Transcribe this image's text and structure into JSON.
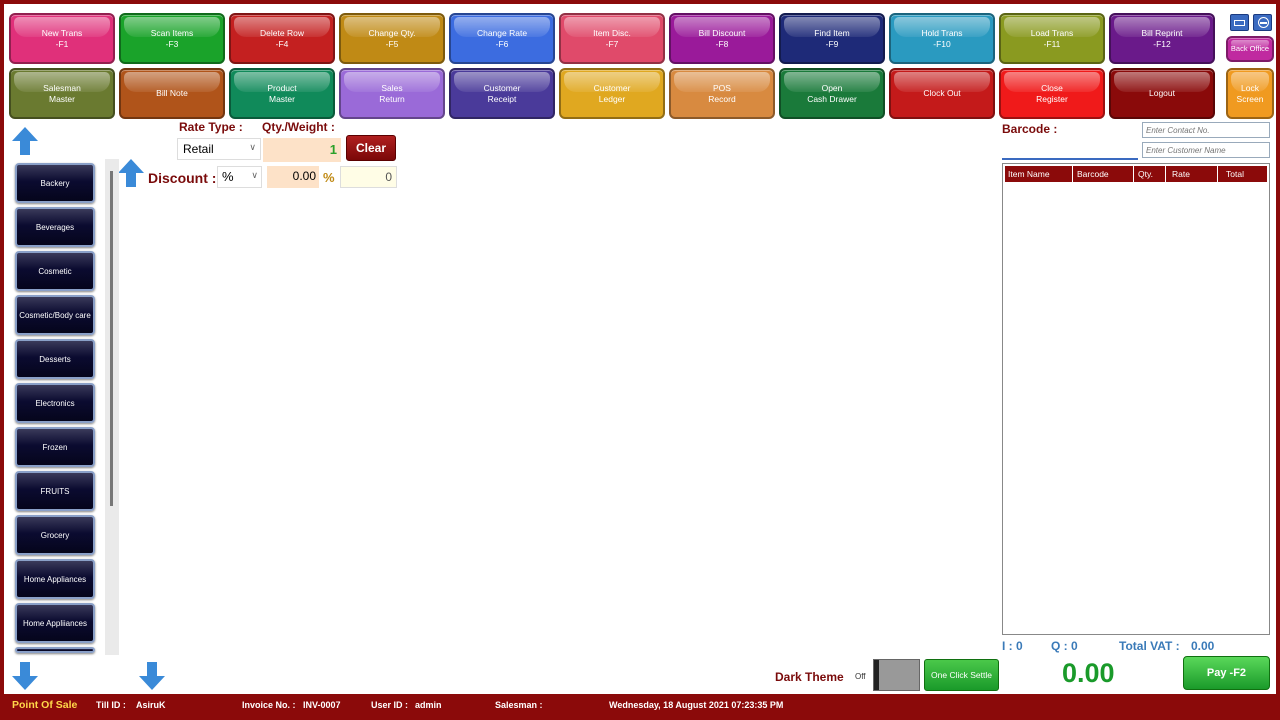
{
  "toolbar_row1": [
    {
      "line1": "New Trans",
      "line2": "-F1",
      "color": "#e0307a"
    },
    {
      "line1": "Scan Items",
      "line2": "-F3",
      "color": "#1aa32a"
    },
    {
      "line1": "Delete Row",
      "line2": "-F4",
      "color": "#c42020"
    },
    {
      "line1": "Change Qty.",
      "line2": "-F5",
      "color": "#c08a15"
    },
    {
      "line1": "Change Rate",
      "line2": "-F6",
      "color": "#3c6ce0"
    },
    {
      "line1": "Item Disc.",
      "line2": "-F7",
      "color": "#e04a6a"
    },
    {
      "line1": "Bill Discount",
      "line2": "-F8",
      "color": "#9a1a9a"
    },
    {
      "line1": "Find Item",
      "line2": "-F9",
      "color": "#1e2a78"
    },
    {
      "line1": "Hold Trans",
      "line2": "-F10",
      "color": "#2a9ac0"
    },
    {
      "line1": "Load Trans",
      "line2": "-F11",
      "color": "#8a9a20"
    },
    {
      "line1": "Bill Reprint",
      "line2": "-F12",
      "color": "#6a1a8a"
    }
  ],
  "toolbar_row2": [
    {
      "line1": "Salesman",
      "line2": "Master",
      "color": "#6a7a30"
    },
    {
      "line1": "Bill Note",
      "line2": "",
      "color": "#b0541a"
    },
    {
      "line1": "Product",
      "line2": "Master",
      "color": "#108a5a"
    },
    {
      "line1": "Sales",
      "line2": "Return",
      "color": "#9a6ad8"
    },
    {
      "line1": "Customer",
      "line2": "Receipt",
      "color": "#4a3a9a"
    },
    {
      "line1": "Customer",
      "line2": "Ledger",
      "color": "#e0a820"
    },
    {
      "line1": "POS",
      "line2": "Record",
      "color": "#d88a40"
    },
    {
      "line1": "Open",
      "line2": "Cash Drawer",
      "color": "#1a7a3a"
    },
    {
      "line1": "Clock Out",
      "line2": "",
      "color": "#c41a1a"
    },
    {
      "line1": "Close",
      "line2": "Register",
      "color": "#f01a1a"
    },
    {
      "line1": "Logout",
      "line2": "",
      "color": "#8a0a0a"
    }
  ],
  "back_office_label": "Back Office",
  "lock_screen": {
    "line1": "Lock",
    "line2": "Screen"
  },
  "rate_type": {
    "label": "Rate Type :",
    "value": "Retail"
  },
  "qty": {
    "label": "Qty./Weight :",
    "value": "1"
  },
  "clear_label": "Clear",
  "discount": {
    "label": "Discount :",
    "type": "%",
    "value": "0.00",
    "unit": "%",
    "amount": "0"
  },
  "categories": [
    "Backery",
    "Beverages",
    "Cosmetic",
    "Cosmetic/Body care",
    "Desserts",
    "Electronics",
    "Frozen",
    "FRUITS",
    "Grocery",
    "Home Appliances",
    "Home Appliiances"
  ],
  "barcode_label": "Barcode :",
  "contact_placeholder": "Enter Contact No.",
  "customer_placeholder": "Enter Customer Name",
  "grid_columns": [
    "Item Name",
    "Barcode",
    "Qty.",
    "Rate",
    "Total"
  ],
  "summary": {
    "items": "I : 0",
    "qty": "Q :  0",
    "vat_label": "Total VAT :",
    "vat_value": "0.00"
  },
  "total": "0.00",
  "pay_label": "Pay  -F2",
  "dark_theme": {
    "label": "Dark Theme",
    "state": "Off"
  },
  "one_click_settle": "One Click Settle",
  "status": {
    "app": "Point Of Sale",
    "till_label": "Till ID :",
    "till_value": "AsiruK",
    "invoice_label": "Invoice No. :",
    "invoice_value": "INV-0007",
    "user_label": "User ID :",
    "user_value": "admin",
    "salesman_label": "Salesman :",
    "datetime": "Wednesday, 18 August 2021 07:23:35 PM"
  },
  "colors": {
    "frame": "#8b0a0a",
    "accent_blue": "#3a8ad8",
    "total_green": "#1a9a2a"
  }
}
